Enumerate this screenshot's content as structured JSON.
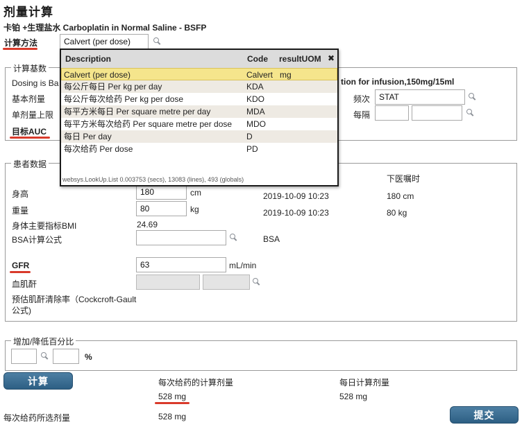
{
  "page_title": "剂量计算",
  "drug_title": "卡铂 +生理盐水 Carboplatin in Normal Saline - BSFP",
  "calc_method": {
    "label": "计算方法",
    "value": "Calvert (per dose)"
  },
  "calc_basis": {
    "legend": "计算基数",
    "dosing_text_left": "Dosing is Ba",
    "dosing_text_right": "tion for infusion,150mg/15ml",
    "basic_dose_label": "基本剂量",
    "single_dose_max_label": "单剂量上限",
    "target_auc_label": "目标AUC",
    "frequency_label": "频次",
    "frequency_value": "STAT",
    "interval_label": "每隔"
  },
  "lookup": {
    "headers": {
      "description": "Description",
      "code": "Code",
      "uom": "resultUOM",
      "close": "✖"
    },
    "rows": [
      {
        "description": "Calvert (per dose)",
        "code": "Calvert",
        "uom": "mg"
      },
      {
        "description": "每公斤每日 Per kg per day",
        "code": "KDA",
        "uom": ""
      },
      {
        "description": "每公斤每次给药 Per kg per dose",
        "code": "KDO",
        "uom": ""
      },
      {
        "description": "每平方米每日 Per square metre per day",
        "code": "MDA",
        "uom": ""
      },
      {
        "description": "每平方米每次给药 Per square metre per dose",
        "code": "MDO",
        "uom": ""
      },
      {
        "description": "每日 Per day",
        "code": "D",
        "uom": ""
      },
      {
        "description": "每次给药 Per dose",
        "code": "PD",
        "uom": ""
      }
    ],
    "footer": "websys.LookUp.List  0.003753 (secs),  13083 (lines),  493 (globals)"
  },
  "patient": {
    "legend": "患者数据",
    "last_order_header": "下医嘱时",
    "height_label": "身高",
    "height_value": "180",
    "height_unit": "cm",
    "height_date": "2019-10-09 10:23",
    "height_last": "180 cm",
    "weight_label": "重量",
    "weight_value": "80",
    "weight_unit": "kg",
    "weight_date": "2019-10-09 10:23",
    "weight_last": "80 kg",
    "bmi_label": "身体主要指标BMI",
    "bmi_value": "24.69",
    "bsa_formula_label": "BSA计算公式",
    "bsa_text": "BSA",
    "gfr_label": "GFR",
    "gfr_value": "63",
    "gfr_unit": "mL/min",
    "creatinine_label": "血肌酐",
    "clearance_label_line1": "预估肌酐清除率（Cockcroft-Gault",
    "clearance_label_line2": "公式)"
  },
  "adjust": {
    "legend": "增加/降低百分比",
    "percent_sign": "%"
  },
  "results": {
    "calc_button": "计算",
    "per_dose_calc_label": "每次给药的计算剂量",
    "per_dose_calc_value": "528 mg",
    "daily_calc_label": "每日计算剂量",
    "daily_calc_value": "528 mg",
    "selected_dose_label": "每次给药所选剂量",
    "selected_dose_value": "528 mg",
    "submit_button": "提交"
  },
  "colors": {
    "accent_underline": "#d93a2b",
    "button": "#3a6b8f",
    "selected_row": "#f5e58c"
  }
}
